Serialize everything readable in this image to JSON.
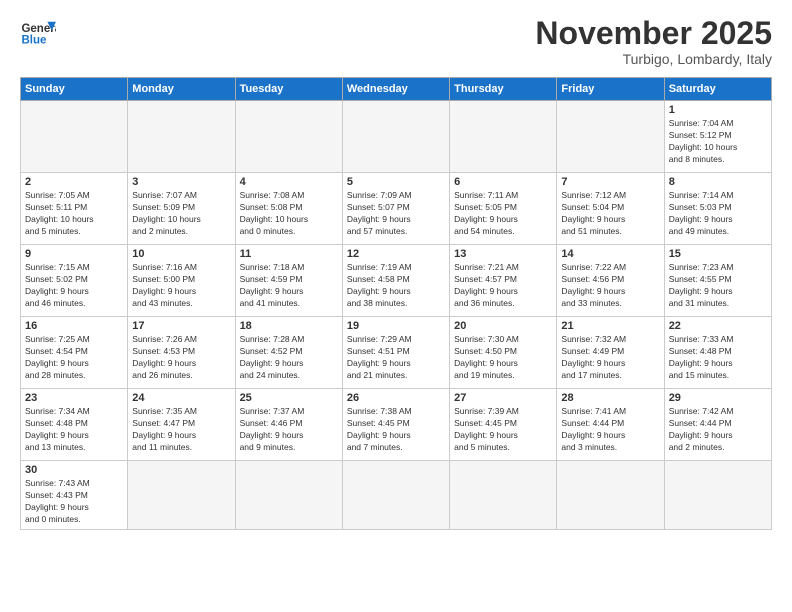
{
  "logo": {
    "line1": "General",
    "line2": "Blue"
  },
  "header": {
    "month": "November 2025",
    "location": "Turbigo, Lombardy, Italy"
  },
  "weekdays": [
    "Sunday",
    "Monday",
    "Tuesday",
    "Wednesday",
    "Thursday",
    "Friday",
    "Saturday"
  ],
  "weeks": [
    [
      {
        "day": "",
        "info": ""
      },
      {
        "day": "",
        "info": ""
      },
      {
        "day": "",
        "info": ""
      },
      {
        "day": "",
        "info": ""
      },
      {
        "day": "",
        "info": ""
      },
      {
        "day": "",
        "info": ""
      },
      {
        "day": "1",
        "info": "Sunrise: 7:04 AM\nSunset: 5:12 PM\nDaylight: 10 hours\nand 8 minutes."
      }
    ],
    [
      {
        "day": "2",
        "info": "Sunrise: 7:05 AM\nSunset: 5:11 PM\nDaylight: 10 hours\nand 5 minutes."
      },
      {
        "day": "3",
        "info": "Sunrise: 7:07 AM\nSunset: 5:09 PM\nDaylight: 10 hours\nand 2 minutes."
      },
      {
        "day": "4",
        "info": "Sunrise: 7:08 AM\nSunset: 5:08 PM\nDaylight: 10 hours\nand 0 minutes."
      },
      {
        "day": "5",
        "info": "Sunrise: 7:09 AM\nSunset: 5:07 PM\nDaylight: 9 hours\nand 57 minutes."
      },
      {
        "day": "6",
        "info": "Sunrise: 7:11 AM\nSunset: 5:05 PM\nDaylight: 9 hours\nand 54 minutes."
      },
      {
        "day": "7",
        "info": "Sunrise: 7:12 AM\nSunset: 5:04 PM\nDaylight: 9 hours\nand 51 minutes."
      },
      {
        "day": "8",
        "info": "Sunrise: 7:14 AM\nSunset: 5:03 PM\nDaylight: 9 hours\nand 49 minutes."
      }
    ],
    [
      {
        "day": "9",
        "info": "Sunrise: 7:15 AM\nSunset: 5:02 PM\nDaylight: 9 hours\nand 46 minutes."
      },
      {
        "day": "10",
        "info": "Sunrise: 7:16 AM\nSunset: 5:00 PM\nDaylight: 9 hours\nand 43 minutes."
      },
      {
        "day": "11",
        "info": "Sunrise: 7:18 AM\nSunset: 4:59 PM\nDaylight: 9 hours\nand 41 minutes."
      },
      {
        "day": "12",
        "info": "Sunrise: 7:19 AM\nSunset: 4:58 PM\nDaylight: 9 hours\nand 38 minutes."
      },
      {
        "day": "13",
        "info": "Sunrise: 7:21 AM\nSunset: 4:57 PM\nDaylight: 9 hours\nand 36 minutes."
      },
      {
        "day": "14",
        "info": "Sunrise: 7:22 AM\nSunset: 4:56 PM\nDaylight: 9 hours\nand 33 minutes."
      },
      {
        "day": "15",
        "info": "Sunrise: 7:23 AM\nSunset: 4:55 PM\nDaylight: 9 hours\nand 31 minutes."
      }
    ],
    [
      {
        "day": "16",
        "info": "Sunrise: 7:25 AM\nSunset: 4:54 PM\nDaylight: 9 hours\nand 28 minutes."
      },
      {
        "day": "17",
        "info": "Sunrise: 7:26 AM\nSunset: 4:53 PM\nDaylight: 9 hours\nand 26 minutes."
      },
      {
        "day": "18",
        "info": "Sunrise: 7:28 AM\nSunset: 4:52 PM\nDaylight: 9 hours\nand 24 minutes."
      },
      {
        "day": "19",
        "info": "Sunrise: 7:29 AM\nSunset: 4:51 PM\nDaylight: 9 hours\nand 21 minutes."
      },
      {
        "day": "20",
        "info": "Sunrise: 7:30 AM\nSunset: 4:50 PM\nDaylight: 9 hours\nand 19 minutes."
      },
      {
        "day": "21",
        "info": "Sunrise: 7:32 AM\nSunset: 4:49 PM\nDaylight: 9 hours\nand 17 minutes."
      },
      {
        "day": "22",
        "info": "Sunrise: 7:33 AM\nSunset: 4:48 PM\nDaylight: 9 hours\nand 15 minutes."
      }
    ],
    [
      {
        "day": "23",
        "info": "Sunrise: 7:34 AM\nSunset: 4:48 PM\nDaylight: 9 hours\nand 13 minutes."
      },
      {
        "day": "24",
        "info": "Sunrise: 7:35 AM\nSunset: 4:47 PM\nDaylight: 9 hours\nand 11 minutes."
      },
      {
        "day": "25",
        "info": "Sunrise: 7:37 AM\nSunset: 4:46 PM\nDaylight: 9 hours\nand 9 minutes."
      },
      {
        "day": "26",
        "info": "Sunrise: 7:38 AM\nSunset: 4:45 PM\nDaylight: 9 hours\nand 7 minutes."
      },
      {
        "day": "27",
        "info": "Sunrise: 7:39 AM\nSunset: 4:45 PM\nDaylight: 9 hours\nand 5 minutes."
      },
      {
        "day": "28",
        "info": "Sunrise: 7:41 AM\nSunset: 4:44 PM\nDaylight: 9 hours\nand 3 minutes."
      },
      {
        "day": "29",
        "info": "Sunrise: 7:42 AM\nSunset: 4:44 PM\nDaylight: 9 hours\nand 2 minutes."
      }
    ],
    [
      {
        "day": "30",
        "info": "Sunrise: 7:43 AM\nSunset: 4:43 PM\nDaylight: 9 hours\nand 0 minutes."
      },
      {
        "day": "",
        "info": ""
      },
      {
        "day": "",
        "info": ""
      },
      {
        "day": "",
        "info": ""
      },
      {
        "day": "",
        "info": ""
      },
      {
        "day": "",
        "info": ""
      },
      {
        "day": "",
        "info": ""
      }
    ]
  ]
}
